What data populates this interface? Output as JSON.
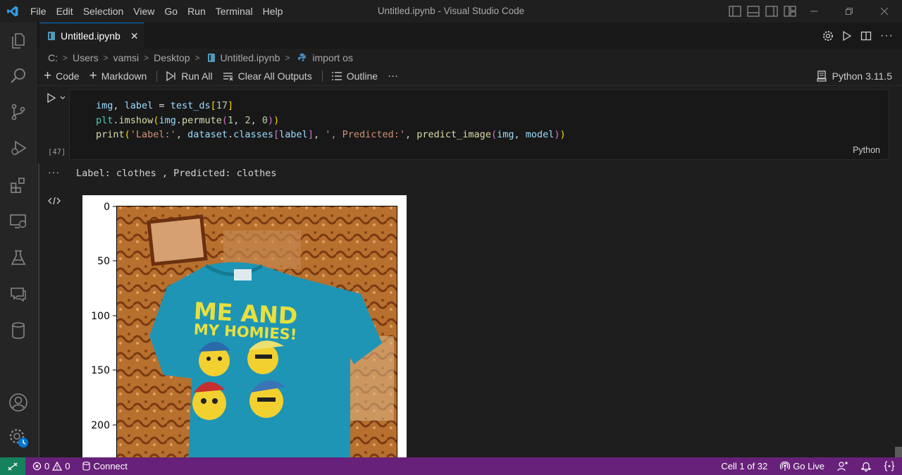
{
  "titlebar": {
    "menu": [
      "File",
      "Edit",
      "Selection",
      "View",
      "Go",
      "Run",
      "Terminal",
      "Help"
    ],
    "window_title": "Untitled.ipynb - Visual Studio Code"
  },
  "tab": {
    "label": "Untitled.ipynb",
    "close_glyph": "✕"
  },
  "breadcrumb": {
    "parts": [
      "C:",
      "Users",
      "vamsi",
      "Desktop",
      "Untitled.ipynb",
      "import os"
    ]
  },
  "toolbar": {
    "add_code": "Code",
    "add_markdown": "Markdown",
    "run_all": "Run All",
    "clear_outputs": "Clear All Outputs",
    "outline": "Outline",
    "more": "···",
    "kernel": "Python 3.11.5"
  },
  "cell": {
    "exec_count": "[47]",
    "language": "Python",
    "output_text": "Label: clothes , Predicted: clothes",
    "output_dots": "···"
  },
  "figure": {
    "y_ticks": [
      "0",
      "50",
      "100",
      "150",
      "200"
    ],
    "shirt_text_line1": "ME AND",
    "shirt_text_line2": "MY HOMIES!"
  },
  "status": {
    "errors": "0",
    "warnings": "0",
    "connect": "Connect",
    "cell_position": "Cell 1 of 32",
    "go_live": "Go Live"
  },
  "colors": {
    "statusbar": "#68217a",
    "remote": "#16825d",
    "accent": "#0078d4"
  }
}
